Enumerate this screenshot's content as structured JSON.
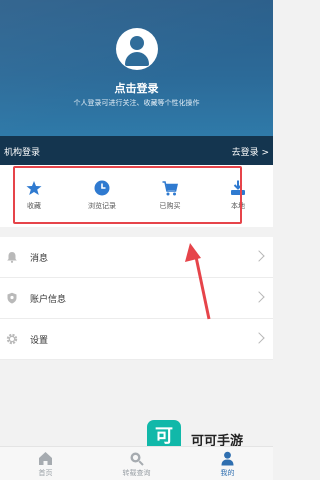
{
  "header": {
    "title": "点击登录",
    "subtitle": "个人登录可进行关注、收藏等个性化操作"
  },
  "org_bar": {
    "left": "机构登录",
    "right": "去登录 >"
  },
  "quick_actions": [
    {
      "label": "收藏",
      "icon": "star-icon"
    },
    {
      "label": "浏览记录",
      "icon": "clock-icon"
    },
    {
      "label": "已购买",
      "icon": "cart-icon"
    },
    {
      "label": "本地",
      "icon": "download-icon"
    }
  ],
  "menu": [
    {
      "label": "消息",
      "icon": "bell-icon"
    },
    {
      "label": "账户信息",
      "icon": "shield-icon"
    },
    {
      "label": "设置",
      "icon": "gear-icon"
    }
  ],
  "tabbar": [
    {
      "label": "首页",
      "icon": "home-icon",
      "active": false
    },
    {
      "label": "转载查询",
      "icon": "search-icon",
      "active": false
    },
    {
      "label": "我的",
      "icon": "user-icon",
      "active": true
    }
  ],
  "watermark": {
    "logo": "可",
    "text": "可可手游"
  },
  "colors": {
    "accent": "#2f7ad0",
    "header": "#2c6a98",
    "org_bar": "#14354f",
    "highlight": "#e6444a"
  }
}
